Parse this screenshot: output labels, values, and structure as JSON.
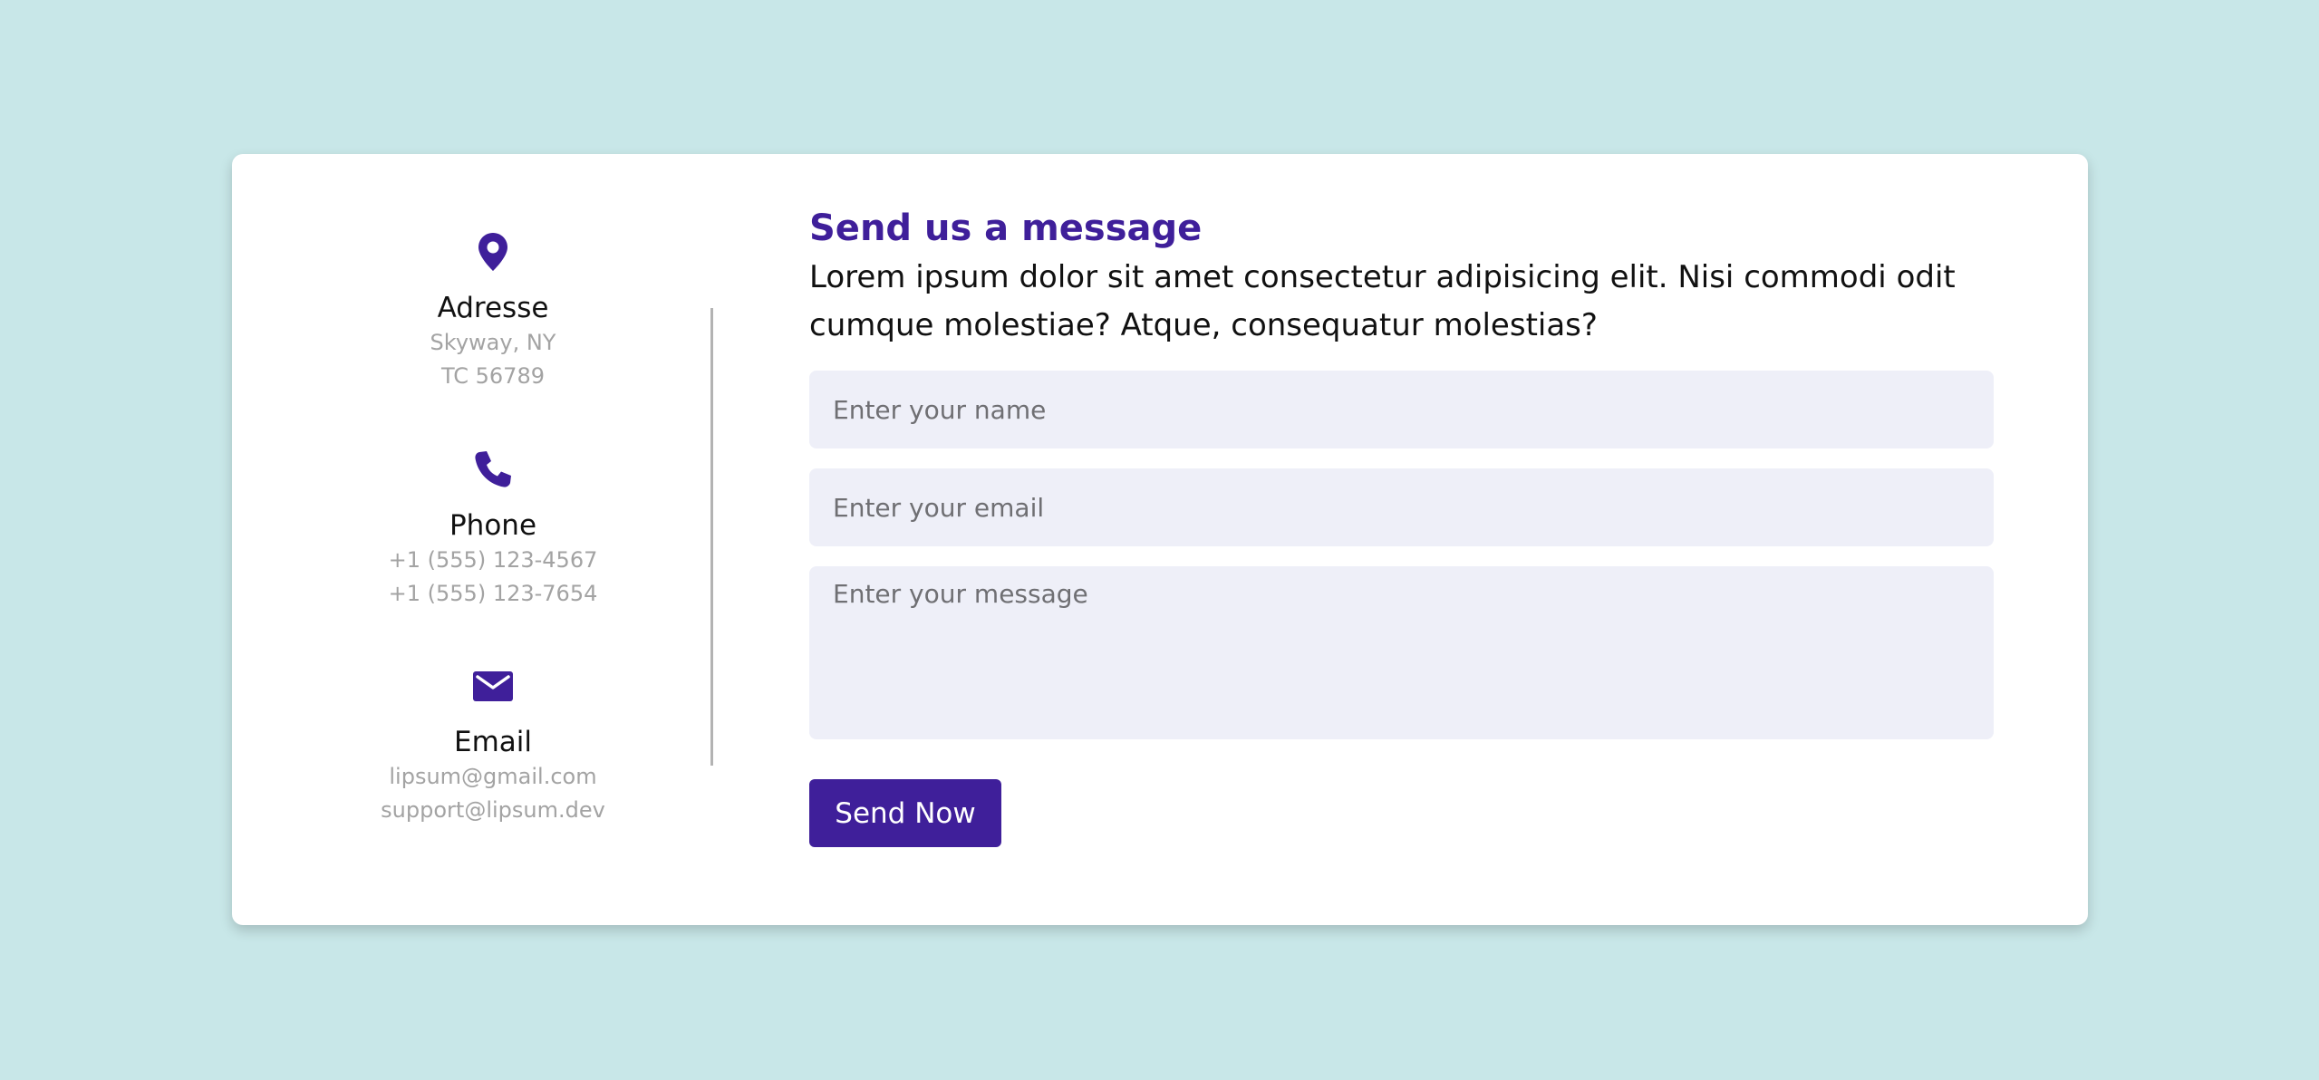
{
  "colors": {
    "background": "#c8e7e8",
    "card": "#ffffff",
    "accent": "#3f1f9a",
    "field_bg": "#eeeff8",
    "muted_text": "#a3a3a3"
  },
  "contact": {
    "address": {
      "icon": "map-pin-icon",
      "title": "Adresse",
      "lines": [
        "Skyway, NY",
        "TC 56789"
      ]
    },
    "phone": {
      "icon": "phone-icon",
      "title": "Phone",
      "lines": [
        "+1 (555) 123-4567",
        "+1 (555) 123-7654"
      ]
    },
    "email": {
      "icon": "envelope-icon",
      "title": "Email",
      "lines": [
        "lipsum@gmail.com",
        "support@lipsum.dev"
      ]
    }
  },
  "form": {
    "title": "Send us a message",
    "description": "Lorem ipsum dolor sit amet consectetur adipisicing elit. Nisi commodi odit cumque molestiae? Atque, consequatur molestias?",
    "name_placeholder": "Enter your name",
    "email_placeholder": "Enter your email",
    "message_placeholder": "Enter your message",
    "submit_label": "Send Now"
  }
}
